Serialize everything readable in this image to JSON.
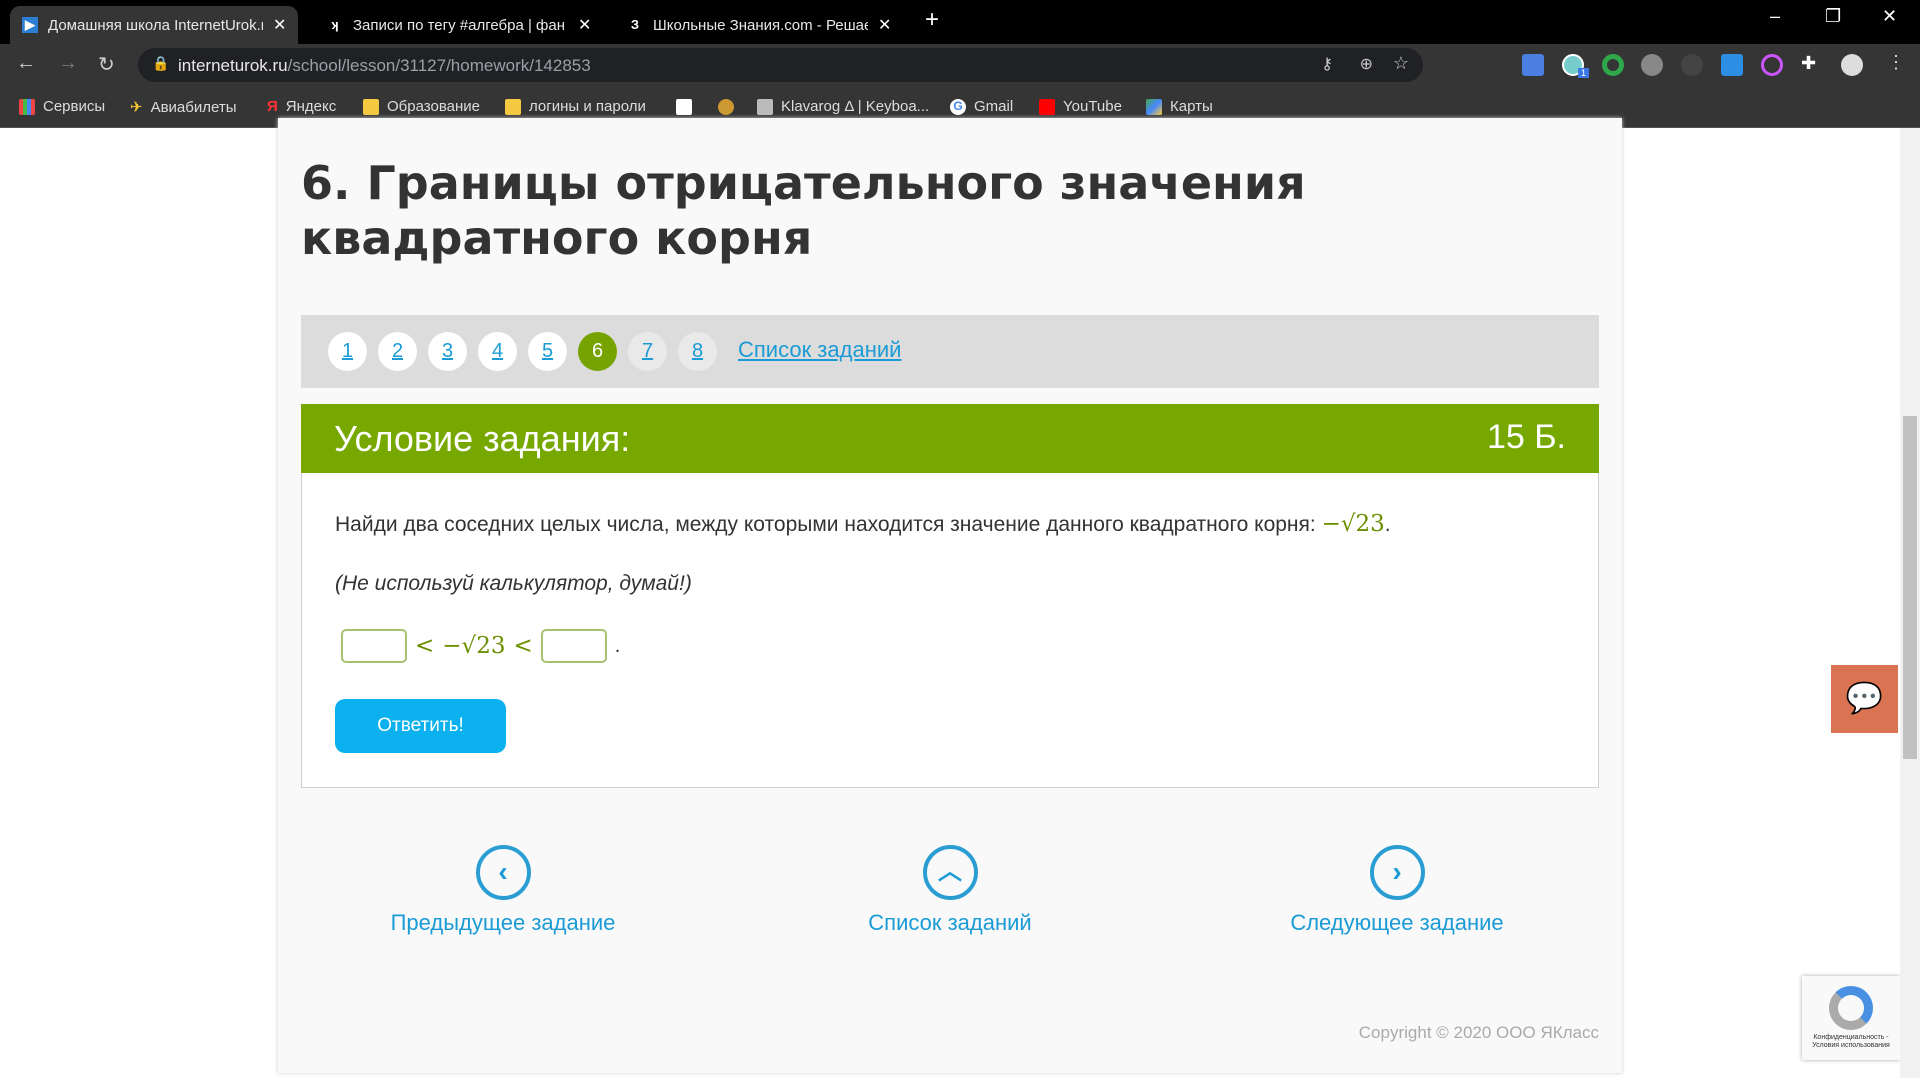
{
  "browser": {
    "tabs": [
      {
        "title": "Домашняя школа InternetUrok.ru",
        "icon": "internet-urok-icon"
      },
      {
        "title": "Записи по тегу #алгебра | фан г",
        "icon": "vk-icon"
      },
      {
        "title": "Школьные Знания.com - Решаем",
        "icon": "znania-icon"
      }
    ],
    "new_tab": "+",
    "url_host": "interneturok.ru",
    "url_path": "/school/lesson/31127/homework/142853",
    "bookmarks": [
      "Сервисы",
      "Авиабилеты",
      "Яндекс",
      "Образование",
      "логины и пароли",
      "Klavarog Δ | Keyboa...",
      "Gmail",
      "YouTube",
      "Карты"
    ],
    "ext_badge": "1"
  },
  "page": {
    "title": "6. Границы отрицательного значения квадратного корня",
    "pages": [
      "1",
      "2",
      "3",
      "4",
      "5",
      "6",
      "7",
      "8"
    ],
    "current_page": "6",
    "task_list_link": "Список заданий",
    "condition_header": "Условие задания:",
    "points": "15 Б.",
    "question": "Найди два соседних целых числа, между которыми находится значение данного квадратного корня:",
    "question_math": "−√23",
    "question_end": ".",
    "note": "(Не используй калькулятор, думай!)",
    "answer_lt1": "<",
    "answer_math": "−√23",
    "answer_lt2": "<",
    "answer_end": ".",
    "submit": "Ответить!",
    "prev": "Предыдущее задание",
    "list": "Список заданий",
    "next": "Следующее задание",
    "copyright": "Copyright © 2020 ООО ЯКласс",
    "recaptcha": "Конфиденциальность - Условия использования"
  },
  "colors": {
    "accent_green": "#76a800",
    "link_blue": "#1a9bd6",
    "button_blue": "#0bb0ee",
    "chat": "#d97352"
  }
}
